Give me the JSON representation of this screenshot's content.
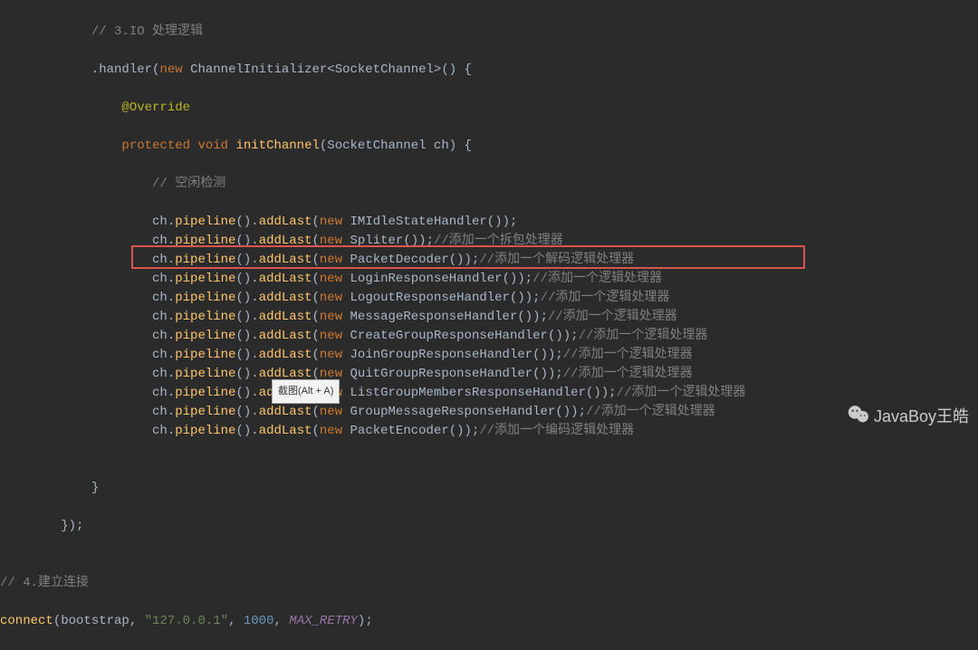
{
  "code": {
    "l1_comment": "// 3.IO 处理逻辑",
    "l2_handler": ".handler(",
    "l2_new": "new",
    "l2_class": " ChannelInitializer<SocketChannel>() {",
    "l3_annotation": "@Override",
    "l4_protected": "protected",
    "l4_void": " void",
    "l4_method": " initChannel",
    "l4_params": "(SocketChannel ch) {",
    "l5_comment": "// 空闲检测",
    "pipeline_calls": [
      {
        "obj": "ch.",
        "m1": "pipeline",
        "dot": "().",
        "m2": "addLast",
        "open": "(",
        "new": "new",
        "cls": " IMIdleStateHandler",
        "close": "());",
        "comment": ""
      },
      {
        "obj": "ch.",
        "m1": "pipeline",
        "dot": "().",
        "m2": "addLast",
        "open": "(",
        "new": "new",
        "cls": " Spliter",
        "close": "());",
        "comment": "//添加一个拆包处理器"
      },
      {
        "obj": "ch.",
        "m1": "pipeline",
        "dot": "().",
        "m2": "addLast",
        "open": "(",
        "new": "new",
        "cls": " PacketDecoder",
        "close": "());",
        "comment": "//添加一个解码逻辑处理器"
      },
      {
        "obj": "ch.",
        "m1": "pipeline",
        "dot": "().",
        "m2": "addLast",
        "open": "(",
        "new": "new",
        "cls": " LoginResponseHandler",
        "close": "());",
        "comment": "//添加一个逻辑处理器"
      },
      {
        "obj": "ch.",
        "m1": "pipeline",
        "dot": "().",
        "m2": "addLast",
        "open": "(",
        "new": "new",
        "cls": " LogoutResponseHandler",
        "close": "());",
        "comment": "//添加一个逻辑处理器"
      },
      {
        "obj": "ch.",
        "m1": "pipeline",
        "dot": "().",
        "m2": "addLast",
        "open": "(",
        "new": "new",
        "cls": " MessageResponseHandler",
        "close": "());",
        "comment": "//添加一个逻辑处理器"
      },
      {
        "obj": "ch.",
        "m1": "pipeline",
        "dot": "().",
        "m2": "addLast",
        "open": "(",
        "new": "new",
        "cls": " CreateGroupResponseHandler",
        "close": "());",
        "comment": "//添加一个逻辑处理器"
      },
      {
        "obj": "ch.",
        "m1": "pipeline",
        "dot": "().",
        "m2": "addLast",
        "open": "(",
        "new": "new",
        "cls": " JoinGroupResponseHandler",
        "close": "());",
        "comment": "//添加一个逻辑处理器"
      },
      {
        "obj": "ch.",
        "m1": "pipeline",
        "dot": "().",
        "m2": "addLast",
        "open": "(",
        "new": "new",
        "cls": " QuitGroupResponseHandler",
        "close": "());",
        "comment": "//添加一个逻辑处理器"
      },
      {
        "obj": "ch.",
        "m1": "pipeline",
        "dot": "().",
        "m2": "addLast",
        "open": "(",
        "new": "new",
        "cls": " ListGroupMembersResponseHandler",
        "close": "());",
        "comment": "//添加一个逻辑处理器"
      },
      {
        "obj": "ch.",
        "m1": "pipeline",
        "dot": "().",
        "m2": "addLast",
        "open": "(",
        "new": "new",
        "cls": " GroupMessageResponseHandler",
        "close": "());",
        "comment": "//添加一个逻辑处理器"
      },
      {
        "obj": "ch.",
        "m1": "pipeline",
        "dot": "().",
        "m2": "addLast",
        "open": "(",
        "new": "new",
        "cls": " PacketEncoder",
        "close": "());",
        "comment": "//添加一个编码逻辑处理器"
      }
    ],
    "blank": "",
    "close_inner": "            }",
    "close_handler": "        });",
    "l_comment4": "// 4.建立连接",
    "connect_call": "connect",
    "connect_open": "(bootstrap, ",
    "connect_str": "\"127.0.0.1\"",
    "connect_mid": ", ",
    "connect_num": "1000",
    "connect_mid2": ", ",
    "connect_const": "MAX_RETRY",
    "connect_close": ");"
  },
  "tooltip": "截图(Alt + A)",
  "watermark": "JavaBoy王皓"
}
